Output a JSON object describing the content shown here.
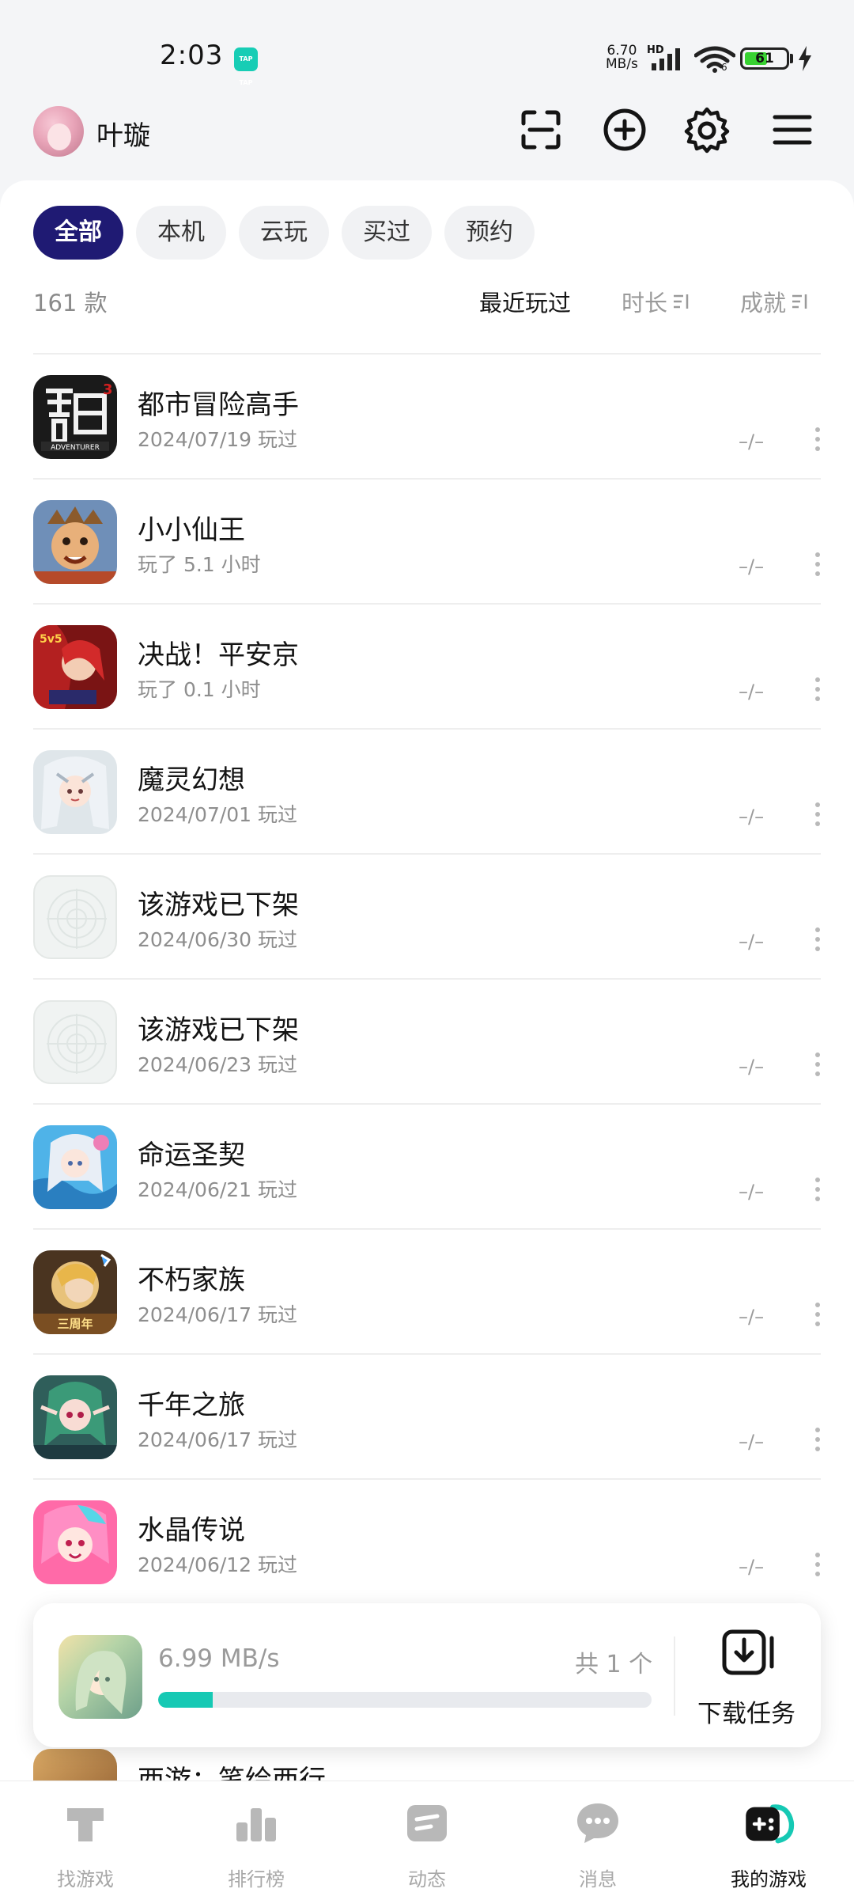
{
  "status_bar": {
    "time": "2:03",
    "app_badge": "TAP TAP",
    "net_speed_value": "6.70",
    "net_speed_unit": "MB/s",
    "network_type": "HD",
    "wifi_label": "6",
    "battery": "61"
  },
  "header": {
    "username": "叶璇",
    "icons": [
      "scan-icon",
      "add-icon",
      "settings-icon",
      "menu-icon"
    ]
  },
  "filter_tabs": [
    "全部",
    "本机",
    "云玩",
    "买过",
    "预约"
  ],
  "active_tab": 0,
  "game_count": "161 款",
  "sort_options": [
    "最近玩过",
    "时长",
    "成就"
  ],
  "games": [
    {
      "name": "都市冒险高手",
      "sub": "2024/07/19 玩过",
      "achievement": "–/–",
      "icon": "adventurer"
    },
    {
      "name": "小小仙王",
      "sub": "玩了 5.1 小时",
      "achievement": "–/–",
      "icon": "monkey"
    },
    {
      "name": "决战！平安京",
      "sub": "玩了 0.1 小时",
      "achievement": "–/–",
      "icon": "heian"
    },
    {
      "name": "魔灵幻想",
      "sub": "2024/07/01 玩过",
      "achievement": "–/–",
      "icon": "moling"
    },
    {
      "name": "该游戏已下架",
      "sub": "2024/06/30 玩过",
      "achievement": "–/–",
      "icon": "placeholder"
    },
    {
      "name": "该游戏已下架",
      "sub": "2024/06/23 玩过",
      "achievement": "–/–",
      "icon": "placeholder"
    },
    {
      "name": "命运圣契",
      "sub": "2024/06/21 玩过",
      "achievement": "–/–",
      "icon": "mingyun"
    },
    {
      "name": "不朽家族",
      "sub": "2024/06/17 玩过",
      "achievement": "–/–",
      "icon": "buxiu"
    },
    {
      "name": "千年之旅",
      "sub": "2024/06/17 玩过",
      "achievement": "–/–",
      "icon": "qiannian"
    },
    {
      "name": "水晶传说",
      "sub": "2024/06/12 玩过",
      "achievement": "–/–",
      "icon": "shuijing"
    }
  ],
  "partial_game": {
    "name": "西游：笔绘西行"
  },
  "download": {
    "speed": "6.99 MB/s",
    "total": "共 1 个",
    "progress": 0.11,
    "task_label": "下载任务"
  },
  "bottom_nav": [
    {
      "label": "找游戏",
      "icon": "find-game-icon"
    },
    {
      "label": "排行榜",
      "icon": "ranking-icon"
    },
    {
      "label": "动态",
      "icon": "feed-icon"
    },
    {
      "label": "消息",
      "icon": "message-icon"
    },
    {
      "label": "我的游戏",
      "icon": "my-games-icon"
    }
  ],
  "active_nav": 4,
  "colors": {
    "accent": "#1f1a73",
    "tap_green": "#16c9b4",
    "battery_green": "#38d232"
  }
}
